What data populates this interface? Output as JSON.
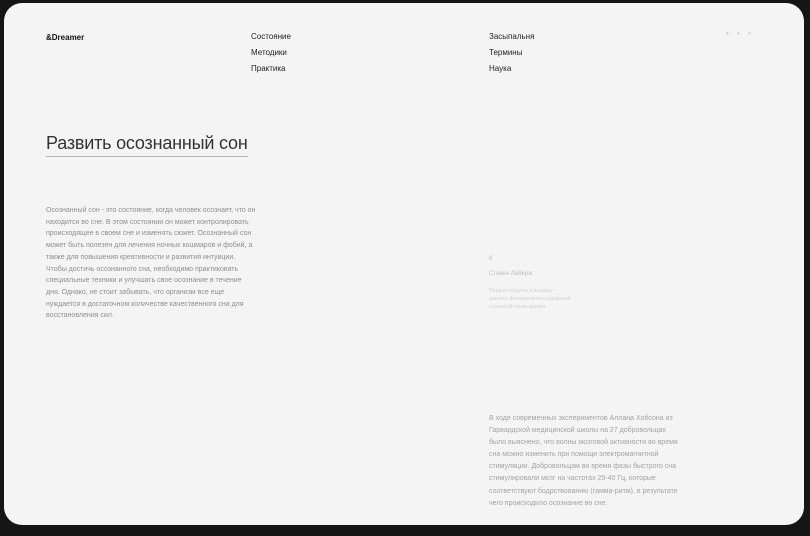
{
  "header": {
    "logo": "&Dreamer",
    "nav_left": [
      "Состояние",
      "Методики",
      "Практика"
    ],
    "nav_right": [
      "Засыпальня",
      "Термины",
      "Наука"
    ],
    "menu_dots": "• • •"
  },
  "main": {
    "title": "Развить осознанный сон",
    "intro": "Осознанный сон - это состояние, когда человек осознает, что он находится во сне. В этом состоянии он может контролировать происходящее в своем сне и изменять сюжет. Осознанный сон может быть полезен для лечения ночных кошмаров и фобий, а также для повышения креативности и развития интуиции. Чтобы достичь осознанного сна, необходимо практиковать специальные техники и улучшать свое осознание в течение дня. Однако, не стоит забывать, что организм все еще нуждается в достаточном количестве качественного сна для восстановления сил."
  },
  "sidebar": {
    "number": "8",
    "author": "Стивен Лаберж",
    "note": "Первая попытка к вопросу данного феномена исследований с научной точки зрения"
  },
  "article": {
    "text": "В ходе современных экспериментов Аллана Хобсона из Гарвардской медицинской школы на 27 добровольцах было выяснено, что волны мозговой активности во время сна можно изменить при помощи электромагнитной стимуляции. Добровольцам во время фазы быстрого сна стимулировали мозг на частотах 25-40 Гц, которые соответствуют бодрствованию (гамма-ритм), в результате чего происходило осознание во сне."
  }
}
